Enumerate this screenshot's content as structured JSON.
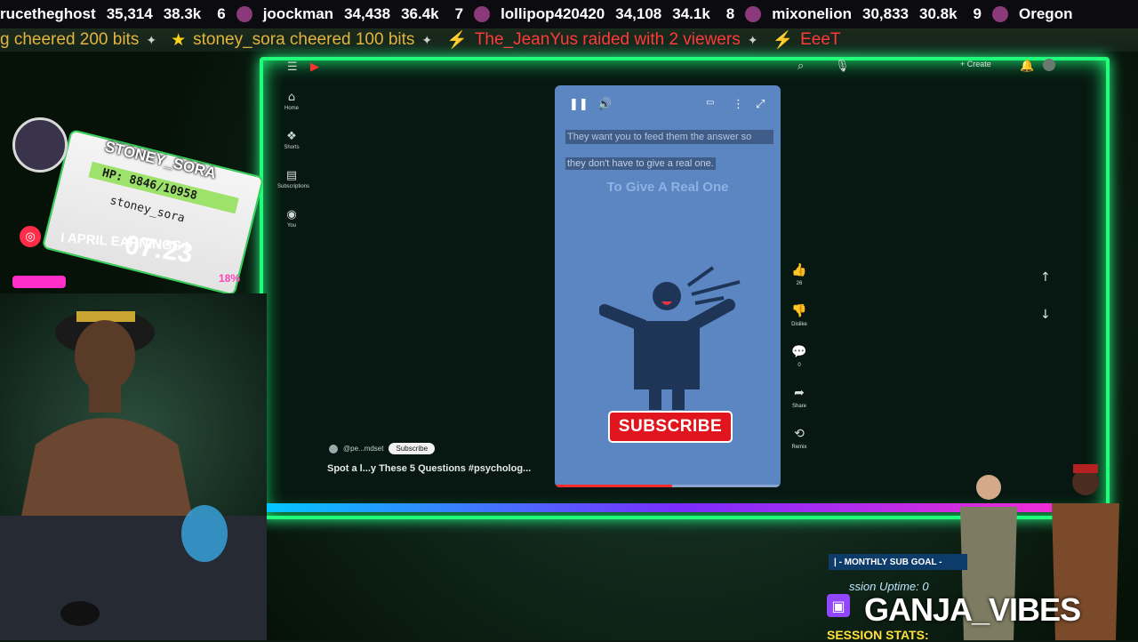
{
  "leaderboard": [
    {
      "rank": "",
      "name": "rucetheghost",
      "points": "35,314",
      "short": "38.3k"
    },
    {
      "rank": "6",
      "name": "joockman",
      "points": "34,438",
      "short": "36.4k"
    },
    {
      "rank": "7",
      "name": "lollipop420420",
      "points": "34,108",
      "short": "34.1k"
    },
    {
      "rank": "8",
      "name": "mixonelion",
      "points": "30,833",
      "short": "30.8k"
    },
    {
      "rank": "9",
      "name": "Oregon",
      "points": "",
      "short": ""
    }
  ],
  "cheers": [
    {
      "text": "g cheered 200 bits",
      "kind": "cheer"
    },
    {
      "text": "stoney_sora cheered 100 bits",
      "kind": "cheer"
    },
    {
      "text": "The_JeanYus raided with 2 viewers",
      "kind": "raid"
    },
    {
      "text": "EeeT",
      "kind": "raid"
    }
  ],
  "overlay": {
    "username": "STONEY_SORA",
    "hp_text": "HP: 8846/10958",
    "hp_fraction": 0.81,
    "handle": "stoney_sora",
    "timer": "07:23",
    "earnings_label": "I APRIL EARNINGS I",
    "earnings_pct": "18%"
  },
  "youtube": {
    "sidebar": [
      {
        "icon": "home-icon",
        "label": "Home"
      },
      {
        "icon": "shorts-icon",
        "label": "Shorts"
      },
      {
        "icon": "subscriptions-icon",
        "label": "Subscriptions"
      },
      {
        "icon": "you-icon",
        "label": "You"
      }
    ],
    "create_label": "+ Create",
    "short": {
      "caption_line1": "They want you to feed them the answer so",
      "caption_line2": "they don't have to give a real one.",
      "overlay_title": "To Give A Real One",
      "subscribe_label": "SUBSCRIBE",
      "progress": 0.52
    },
    "actions": [
      {
        "icon": "like-icon",
        "label": "26"
      },
      {
        "icon": "dislike-icon",
        "label": "Dislike"
      },
      {
        "icon": "comment-icon",
        "label": "0"
      },
      {
        "icon": "share-icon",
        "label": "Share"
      },
      {
        "icon": "remix-icon",
        "label": "Remix"
      }
    ],
    "channel_handle": "@pe...mdset",
    "subscribe_small": "Subscribe",
    "short_title": "Spot a l...y These 5 Questions #psycholog..."
  },
  "bottom_right": {
    "sub_goal": "| - MONTHLY SUB GOAL -",
    "uptime": "ssion Uptime: 0",
    "channel": "GANJA_VIBES",
    "stats": "SESSION STATS:"
  },
  "colors": {
    "neon_green": "#1fff7a",
    "subscribe_red": "#e0151e",
    "bits_gold": "#e3b43e",
    "raid_red": "#ff3a3a",
    "twitch_purple": "#9146ff"
  }
}
